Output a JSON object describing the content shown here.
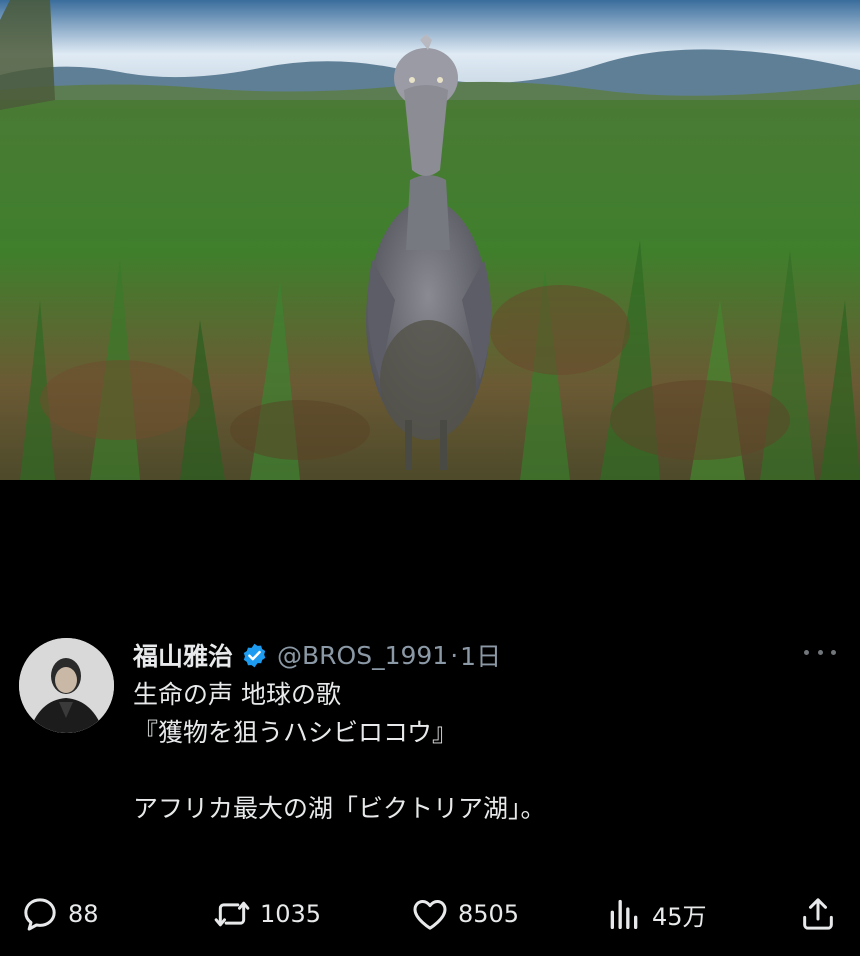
{
  "media": {
    "alt_icon": "shoebill-photo"
  },
  "tweet": {
    "author_name": "福山雅治",
    "handle": "@BROS_1991",
    "separator": "·",
    "time": "1日",
    "body_lines": [
      "生命の声 地球の歌",
      "『獲物を狙うハシビロコウ』",
      "",
      "アフリカ最大の湖「ビクトリア湖」。"
    ],
    "actions": {
      "replies": "88",
      "reposts": "1035",
      "likes": "8505",
      "views": "45万"
    }
  },
  "colors": {
    "verified": "#1d9bf0",
    "muted": "#8b98a5",
    "background": "#000000"
  }
}
